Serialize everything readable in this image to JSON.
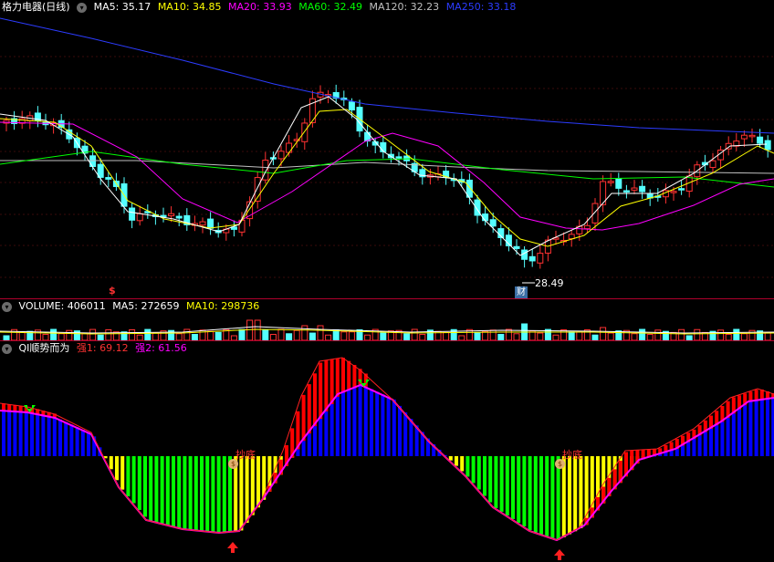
{
  "main": {
    "title": "格力电器(日线)",
    "ma": [
      {
        "label": "MA5: 35.17",
        "color": "#ffffff"
      },
      {
        "label": "MA10: 34.85",
        "color": "#ffff00"
      },
      {
        "label": "MA20: 33.93",
        "color": "#ff00ff"
      },
      {
        "label": "MA60: 32.49",
        "color": "#00ff00"
      },
      {
        "label": "MA120: 32.23",
        "color": "#c0c0c0"
      },
      {
        "label": "MA250: 33.18",
        "color": "#2c3cff"
      }
    ],
    "low_label": "28.49",
    "cai_label": "财",
    "s_label": "$"
  },
  "volume": {
    "label": "VOLUME: 406011",
    "ma5": "MA5: 272659",
    "ma10": "MA10: 298736"
  },
  "indicator": {
    "title": "QI顺势而为",
    "s1": "强1: 69.12",
    "s2": "强2: 61.56",
    "buy_labels": [
      "抄底",
      "抄底"
    ],
    "coin": "$"
  },
  "colors": {
    "up": "#ff3232",
    "down": "#54ffff",
    "blue_bar": "#0000ff",
    "yellow_bar": "#ffff00",
    "green_bar": "#00ff00",
    "red_bar": "#ff0000",
    "separator": "#b0002c"
  }
}
